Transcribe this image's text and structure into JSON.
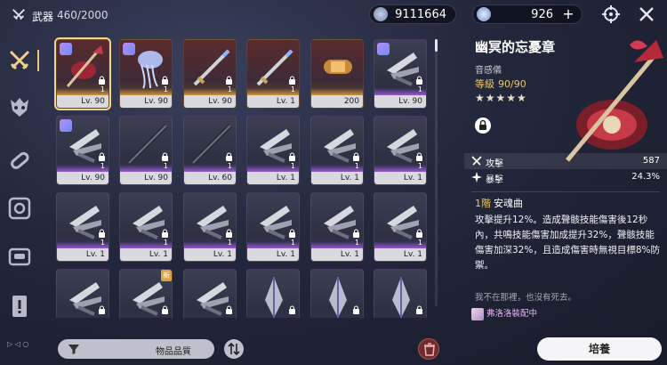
{
  "header": {
    "title": "武器",
    "count": "460/2000",
    "currency1": "9111664",
    "currency2": "926",
    "plus_label": "+"
  },
  "sidebar": {
    "items": [
      {
        "name": "weapons",
        "icon": "crossed-swords-icon",
        "active": true
      },
      {
        "name": "echo",
        "icon": "demon-mask-icon",
        "active": false
      },
      {
        "name": "materials",
        "icon": "capsule-icon",
        "active": false
      },
      {
        "name": "devices",
        "icon": "gear-disc-icon",
        "active": false
      },
      {
        "name": "supplies",
        "icon": "chest-icon",
        "active": false
      },
      {
        "name": "special",
        "icon": "exclamation-card-icon",
        "active": false
      }
    ]
  },
  "grid": {
    "items": [
      {
        "type": "rectifier-gold",
        "level": "Lv. 90",
        "count": "1",
        "rarity": "gold",
        "selected": true,
        "badge": true,
        "new": false,
        "lock": true
      },
      {
        "type": "rectifier-blue",
        "level": "Lv. 90",
        "count": "1",
        "rarity": "gold",
        "selected": false,
        "badge": true,
        "new": false,
        "lock": true
      },
      {
        "type": "sword",
        "level": "Lv. 90",
        "count": "1",
        "rarity": "gold",
        "selected": false,
        "badge": false,
        "new": false,
        "lock": true
      },
      {
        "type": "sword",
        "level": "Lv. 1",
        "count": "1",
        "rarity": "gold",
        "selected": false,
        "badge": false,
        "new": false,
        "lock": true
      },
      {
        "type": "capsule",
        "level": "200",
        "count": "",
        "rarity": "gold",
        "selected": false,
        "badge": false,
        "new": false,
        "lock": false
      },
      {
        "type": "gauntlet",
        "level": "Lv. 90",
        "count": "1",
        "rarity": "purple",
        "selected": false,
        "badge": true,
        "new": false,
        "lock": true
      },
      {
        "type": "gauntlet",
        "level": "Lv. 90",
        "count": "1",
        "rarity": "purple",
        "selected": false,
        "badge": true,
        "new": false,
        "lock": true
      },
      {
        "type": "staff",
        "level": "Lv. 90",
        "count": "1",
        "rarity": "purple",
        "selected": false,
        "badge": false,
        "new": false,
        "lock": true
      },
      {
        "type": "staff",
        "level": "Lv. 60",
        "count": "1",
        "rarity": "purple",
        "selected": false,
        "badge": false,
        "new": false,
        "lock": true
      },
      {
        "type": "gauntlet",
        "level": "Lv. 1",
        "count": "1",
        "rarity": "purple",
        "selected": false,
        "badge": false,
        "new": false,
        "lock": true
      },
      {
        "type": "gauntlet",
        "level": "Lv. 1",
        "count": "1",
        "rarity": "purple",
        "selected": false,
        "badge": false,
        "new": false,
        "lock": true
      },
      {
        "type": "gauntlet",
        "level": "Lv. 1",
        "count": "1",
        "rarity": "purple",
        "selected": false,
        "badge": false,
        "new": false,
        "lock": true
      },
      {
        "type": "gauntlet",
        "level": "Lv. 1",
        "count": "1",
        "rarity": "purple",
        "selected": false,
        "badge": false,
        "new": false,
        "lock": true
      },
      {
        "type": "gauntlet",
        "level": "Lv. 1",
        "count": "1",
        "rarity": "purple",
        "selected": false,
        "badge": false,
        "new": false,
        "lock": true
      },
      {
        "type": "gauntlet",
        "level": "Lv. 1",
        "count": "1",
        "rarity": "purple",
        "selected": false,
        "badge": false,
        "new": false,
        "lock": true
      },
      {
        "type": "gauntlet",
        "level": "Lv. 1",
        "count": "1",
        "rarity": "purple",
        "selected": false,
        "badge": false,
        "new": false,
        "lock": true
      },
      {
        "type": "gauntlet",
        "level": "Lv. 1",
        "count": "1",
        "rarity": "purple",
        "selected": false,
        "badge": false,
        "new": false,
        "lock": true
      },
      {
        "type": "gauntlet",
        "level": "Lv. 1",
        "count": "1",
        "rarity": "purple",
        "selected": false,
        "badge": false,
        "new": false,
        "lock": true
      },
      {
        "type": "gauntlet",
        "level": "",
        "count": "",
        "rarity": "purple",
        "selected": false,
        "badge": false,
        "new": false,
        "lock": true
      },
      {
        "type": "gauntlet",
        "level": "",
        "count": "",
        "rarity": "purple",
        "selected": false,
        "badge": false,
        "new": true,
        "lock": true
      },
      {
        "type": "gauntlet",
        "level": "",
        "count": "",
        "rarity": "purple",
        "selected": false,
        "badge": false,
        "new": false,
        "lock": true
      },
      {
        "type": "crystal",
        "level": "",
        "count": "",
        "rarity": "purple",
        "selected": false,
        "badge": false,
        "new": false,
        "lock": true
      },
      {
        "type": "crystal",
        "level": "",
        "count": "",
        "rarity": "purple",
        "selected": false,
        "badge": false,
        "new": false,
        "lock": true
      },
      {
        "type": "crystal",
        "level": "",
        "count": "",
        "rarity": "purple",
        "selected": false,
        "badge": false,
        "new": false,
        "lock": true
      }
    ],
    "new_label": "新"
  },
  "bottom": {
    "filter_label": "物品品質"
  },
  "detail": {
    "name": "幽冥的忘憂章",
    "type": "音感儀",
    "level_label": "等級",
    "level_value": "90/90",
    "stars": "★★★★★",
    "stats": [
      {
        "icon": "crossed-swords-icon",
        "name": "攻擊",
        "value": "587"
      },
      {
        "icon": "crit-star-icon",
        "name": "暴擊",
        "value": "24.3%"
      }
    ],
    "refine_level": "1階",
    "refine_name": "安魂曲",
    "effect": "攻擊提升12%。造成聲骸技能傷害後12秒內，共鳴技能傷害加成提升32%，聲骸技能傷害加深32%，且造成傷害時無視目標8%防禦。",
    "flavor": "我不在那裡，也沒有死去。",
    "equipped_by": "弗洛洛裝配中",
    "cultivate_label": "培養"
  }
}
